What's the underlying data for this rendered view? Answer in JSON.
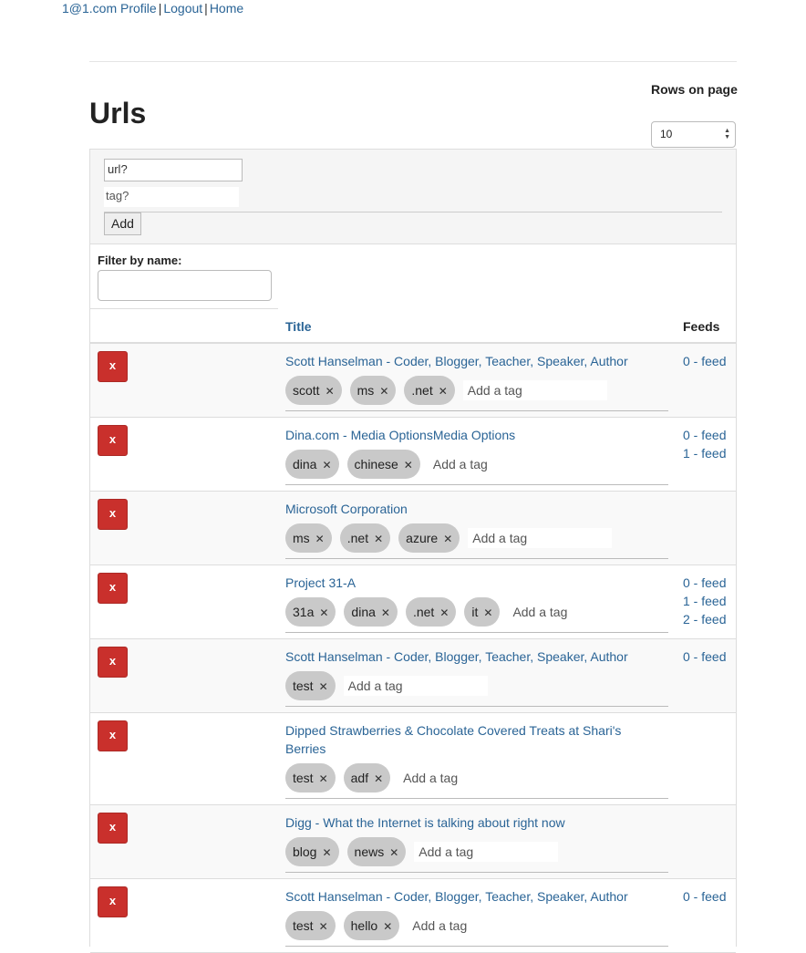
{
  "nav": {
    "profile": "1@1.com Profile",
    "logout": "Logout",
    "home": "Home",
    "separator": "|"
  },
  "page": {
    "title": "Urls",
    "rows_label": "Rows on page",
    "rows_value": "10"
  },
  "add_form": {
    "url_placeholder": "url?",
    "tag_placeholder": "tag?",
    "add_label": "Add"
  },
  "filter": {
    "label": "Filter by name:",
    "value": ""
  },
  "table": {
    "col_title": "Title",
    "col_feeds": "Feeds"
  },
  "icons": {
    "delete": "close-x-icon",
    "tag_remove": "times-icon"
  },
  "colors": {
    "link": "#2a6496",
    "delete": "#c9302c",
    "tag": "#c9c9c9"
  },
  "rows": [
    {
      "delete": "x",
      "title": "Scott Hanselman - Coder, Blogger, Teacher, Speaker, Author",
      "tags": [
        "scott",
        "ms",
        ".net"
      ],
      "add_tag": "Add a tag",
      "feeds": [
        "0 - feed"
      ]
    },
    {
      "delete": "x",
      "title": "Dina.com - Media OptionsMedia Options",
      "tags": [
        "dina",
        "chinese"
      ],
      "add_tag": "Add a tag",
      "feeds": [
        "0 - feed",
        "1 - feed"
      ]
    },
    {
      "delete": "x",
      "title": "Microsoft Corporation",
      "tags": [
        "ms",
        ".net",
        "azure"
      ],
      "add_tag": "Add a tag",
      "feeds": []
    },
    {
      "delete": "x",
      "title": "Project 31-A",
      "tags": [
        "31a",
        "dina",
        ".net",
        "it"
      ],
      "add_tag": "Add a tag",
      "feeds": [
        "0 - feed",
        "1 - feed",
        "2 - feed"
      ]
    },
    {
      "delete": "x",
      "title": "Scott Hanselman - Coder, Blogger, Teacher, Speaker, Author",
      "tags": [
        "test"
      ],
      "add_tag": "Add a tag",
      "feeds": [
        "0 - feed"
      ]
    },
    {
      "delete": "x",
      "title": " Dipped Strawberries & Chocolate Covered Treats at Shari's Berries",
      "tags": [
        "test",
        "adf"
      ],
      "add_tag": "Add a tag",
      "feeds": []
    },
    {
      "delete": "x",
      "title": "Digg - What the Internet is talking about right now",
      "tags": [
        "blog",
        "news"
      ],
      "add_tag": "Add a tag",
      "feeds": []
    },
    {
      "delete": "x",
      "title": "Scott Hanselman - Coder, Blogger, Teacher, Speaker, Author",
      "tags": [
        "test",
        "hello"
      ],
      "add_tag": "Add a tag",
      "feeds": [
        "0 - feed"
      ]
    }
  ]
}
